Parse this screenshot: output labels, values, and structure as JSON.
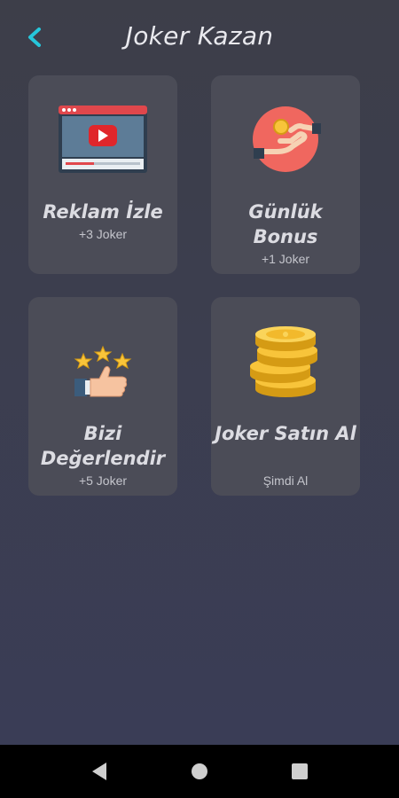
{
  "header": {
    "title": "Joker Kazan",
    "back_icon": "chevron-left-icon",
    "accent_color": "#26c6da"
  },
  "cards": [
    {
      "title": "Reklam İzle",
      "subtitle": "+3 Joker",
      "icon": "video-ad-icon"
    },
    {
      "title": "Günlük Bonus",
      "subtitle": "+1 Joker",
      "icon": "hand-coin-icon"
    },
    {
      "title": "Bizi Değerlendir",
      "subtitle": "+5 Joker",
      "icon": "thumbs-up-stars-icon"
    },
    {
      "title": "Joker Satın Al",
      "subtitle": "Şimdi Al",
      "icon": "gold-coins-icon"
    }
  ],
  "navbar": {
    "buttons": [
      "back-triangle-icon",
      "home-circle-icon",
      "recents-square-icon"
    ]
  },
  "colors": {
    "background": "#3d3e49",
    "card": "#4b4c57",
    "text": "#dcdce2"
  }
}
